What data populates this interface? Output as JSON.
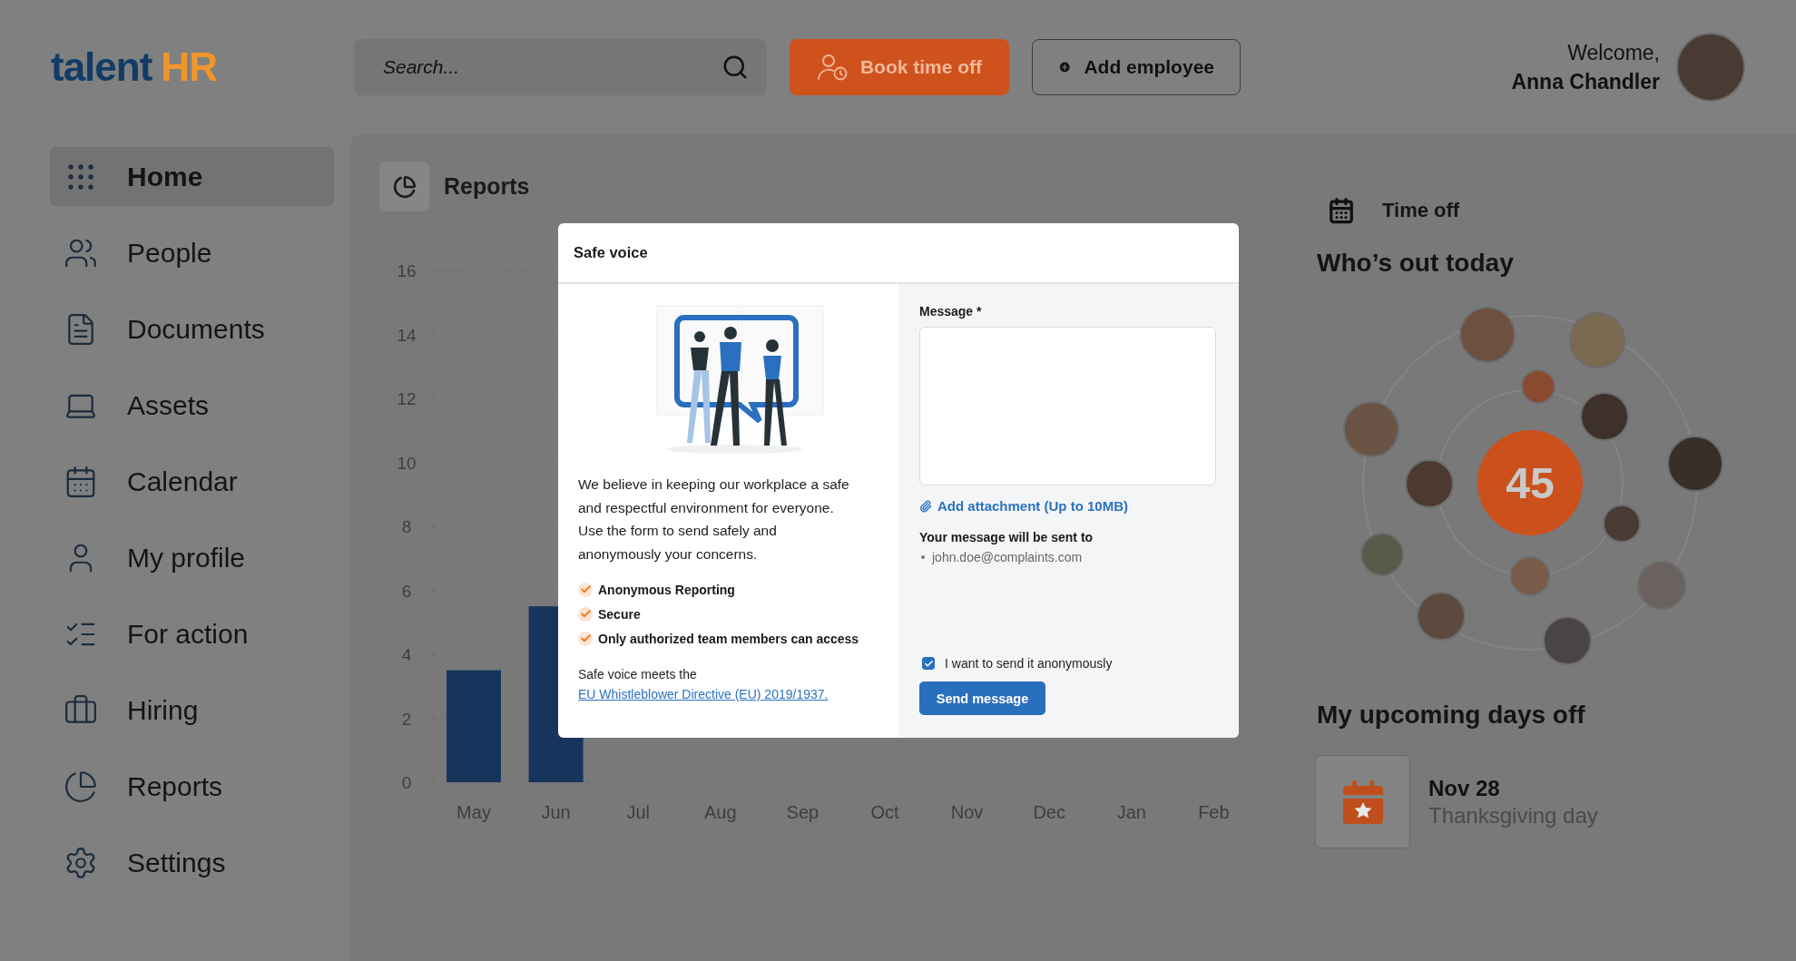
{
  "header": {
    "logo": {
      "part_1": "talent",
      "part_2": "HR"
    },
    "search": {
      "placeholder": "Search..."
    },
    "buttons": [
      {
        "kind": "primary",
        "label": "Book time off"
      },
      {
        "kind": "outline",
        "label": "Add employee"
      }
    ],
    "user": {
      "greeting": "Welcome,",
      "name": "Anna Chandler"
    }
  },
  "sidebar": {
    "items": [
      {
        "label": "Home",
        "selected": true
      },
      {
        "label": "People",
        "selected": false
      },
      {
        "label": "Documents",
        "selected": false
      },
      {
        "label": "Assets",
        "selected": false
      },
      {
        "label": "Calendar",
        "selected": false
      },
      {
        "label": "My profile",
        "selected": false
      },
      {
        "label": "For action",
        "selected": false
      },
      {
        "label": "Hiring",
        "selected": false
      },
      {
        "label": "Reports",
        "selected": false
      },
      {
        "label": "Settings",
        "selected": false
      }
    ]
  },
  "reports": {
    "title": "Reports",
    "chart_data": {
      "type": "bar",
      "categories": [
        "May",
        "Jun",
        "Jul",
        "Aug",
        "Sep",
        "Oct",
        "Nov",
        "Dec",
        "Jan",
        "Feb"
      ],
      "values": [
        3.5,
        5.5,
        null,
        null,
        null,
        null,
        null,
        null,
        null,
        null
      ],
      "grid": true,
      "ylim": [
        0,
        16
      ],
      "yticks": [
        0,
        2,
        4,
        6,
        8,
        10,
        12,
        14,
        16
      ]
    }
  },
  "time_off": {
    "title": "Time off",
    "whos_out": {
      "heading": "Who’s out today",
      "count": "45"
    },
    "upcoming": {
      "heading": "My upcoming days off",
      "items": [
        {
          "date": "Nov 28",
          "name": "Thanksgiving day"
        }
      ]
    }
  },
  "modal": {
    "title": "Safe voice",
    "intro": "We believe in keeping our workplace a safe and respectful environment for everyone. Use the form to send safely and anonymously your concerns.",
    "features": [
      "Anonymous Reporting",
      "Secure",
      "Only authorized team members can access"
    ],
    "compliance_text": "Safe voice meets the",
    "compliance_link": "EU Whistleblower Directive (EU) 2019/1937.",
    "message_label": "Message *",
    "attachment_link": "Add attachment (Up to 10MB)",
    "recipients_label": "Your message will be sent to",
    "recipients": [
      "john.doe@complaints.com"
    ],
    "anonymous": {
      "label": "I want to send it anonymously",
      "checked": true
    },
    "send_button": "Send message"
  }
}
